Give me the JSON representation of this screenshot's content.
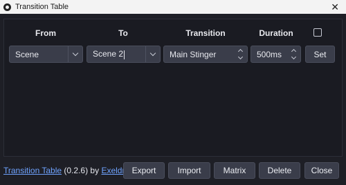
{
  "window": {
    "title": "Transition Table",
    "close_glyph": "✕"
  },
  "headers": {
    "from": "From",
    "to": "To",
    "transition": "Transition",
    "duration": "Duration"
  },
  "row": {
    "from": "Scene",
    "to": "Scene 2",
    "transition": "Main Stinger",
    "duration": "500ms",
    "set_label": "Set"
  },
  "footer": {
    "plugin_link": "Transition Table",
    "version": "(0.2.6) by",
    "author_link": "Exeldro",
    "buttons": {
      "export": "Export",
      "import": "Import",
      "matrix": "Matrix",
      "delete": "Delete",
      "close": "Close"
    }
  },
  "colors": {
    "link": "#6fa3ff",
    "background": "#1e1f26",
    "button": "#3a3d4a"
  }
}
